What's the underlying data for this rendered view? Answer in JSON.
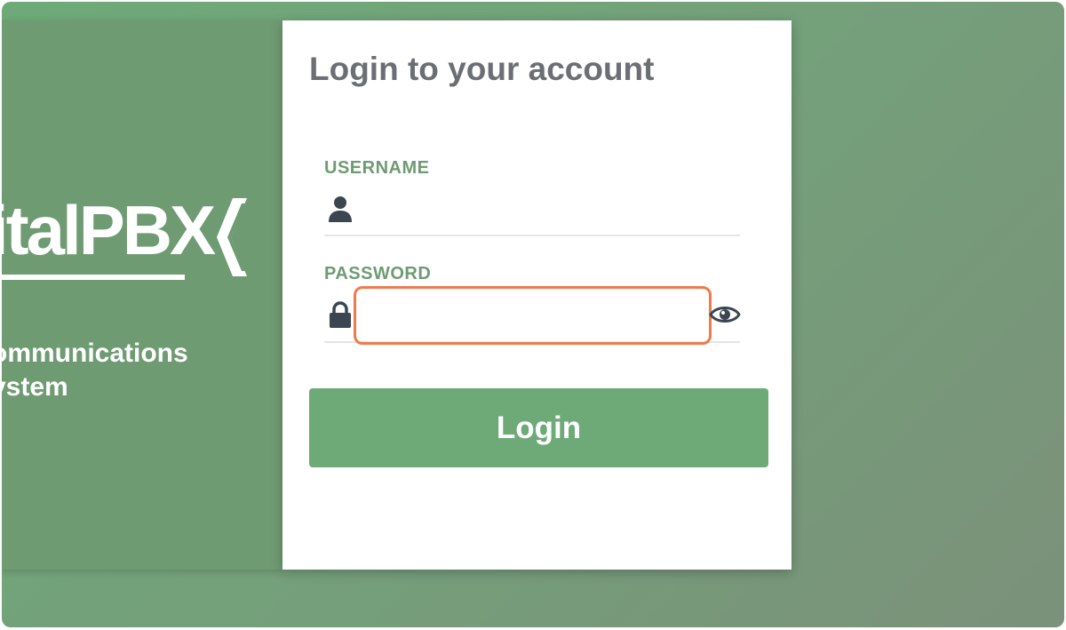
{
  "brand": {
    "logo_text": "italPBX",
    "tagline_line1": "ommunications",
    "tagline_line2": "ystem"
  },
  "login": {
    "title": "Login to your account",
    "username_label": "USERNAME",
    "username_value": "",
    "password_label": "PASSWORD",
    "password_value": "",
    "submit_label": "Login"
  },
  "icons": {
    "username": "user-icon",
    "password": "lock-icon",
    "reveal": "eye-icon"
  },
  "colors": {
    "accent": "#6eaa78",
    "panel": "#6f9b73",
    "label": "#6f9b73",
    "title": "#6b6e73",
    "focus": "#f07a4a"
  }
}
